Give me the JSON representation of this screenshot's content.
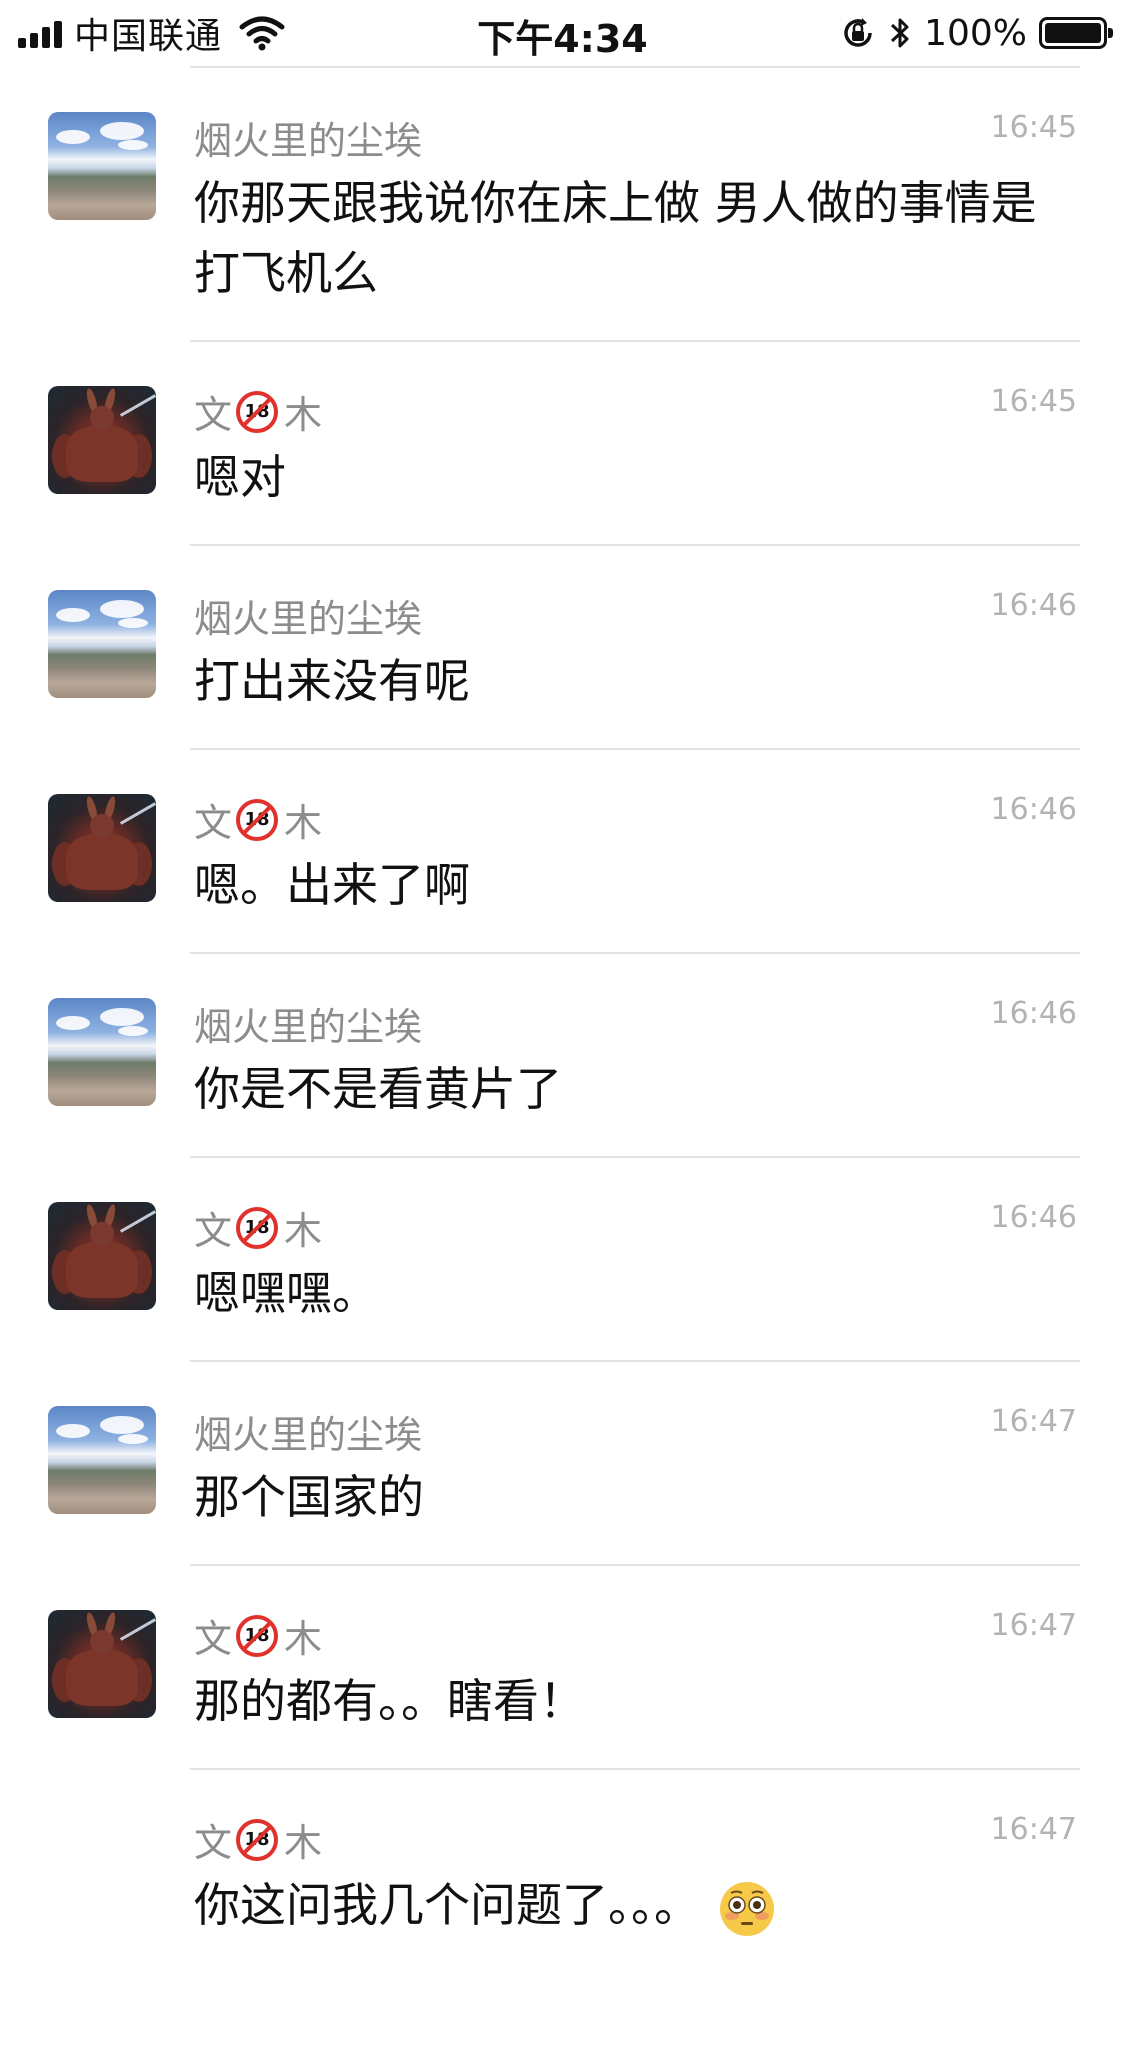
{
  "status_bar": {
    "carrier": "中国联通",
    "time": "下午4:34",
    "battery_percent": "100%",
    "battery_level": 1.0
  },
  "messages": [
    {
      "sender": "烟火里的尘埃",
      "time": "16:45",
      "text": "你那天跟我说你在床上做  男人做的事情是打飞机么",
      "avatar": "landscape-avatar"
    },
    {
      "sender_prefix": "文",
      "sender_suffix": "木",
      "badge": "18-prohibited-icon",
      "time": "16:45",
      "text": "嗯对",
      "avatar": "rabbit-avatar"
    },
    {
      "sender": "烟火里的尘埃",
      "time": "16:46",
      "text": "打出来没有呢",
      "avatar": "landscape-avatar"
    },
    {
      "sender_prefix": "文",
      "sender_suffix": "木",
      "badge": "18-prohibited-icon",
      "time": "16:46",
      "text": "嗯。出来了啊",
      "avatar": "rabbit-avatar"
    },
    {
      "sender": "烟火里的尘埃",
      "time": "16:46",
      "text": "你是不是看黄片了",
      "avatar": "landscape-avatar"
    },
    {
      "sender_prefix": "文",
      "sender_suffix": "木",
      "badge": "18-prohibited-icon",
      "time": "16:46",
      "text": "嗯嘿嘿。",
      "avatar": "rabbit-avatar"
    },
    {
      "sender": "烟火里的尘埃",
      "time": "16:47",
      "text": "那个国家的",
      "avatar": "landscape-avatar"
    },
    {
      "sender_prefix": "文",
      "sender_suffix": "木",
      "badge": "18-prohibited-icon",
      "time": "16:47",
      "text": "那的都有。。瞎看！",
      "avatar": "rabbit-avatar"
    },
    {
      "sender_prefix": "文",
      "sender_suffix": "木",
      "badge": "18-prohibited-icon",
      "time": "16:47",
      "text": "你这问我几个问题了。。。",
      "trailing_icon": "flushed-face-icon"
    }
  ]
}
